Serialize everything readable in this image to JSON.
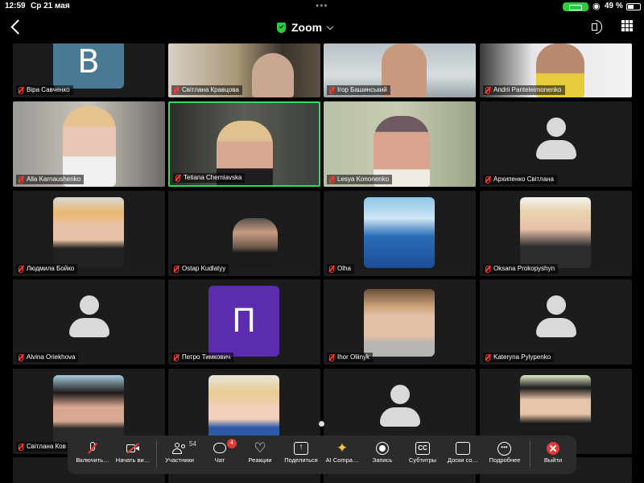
{
  "status_bar": {
    "time": "12:59",
    "date": "Ср 21 мая",
    "battery_percent": "49 %",
    "battery_level": 49
  },
  "header": {
    "title": "Zoom",
    "secure_icon": "shield-check-icon",
    "back_icon": "chevron-left-icon",
    "audio_icon": "speaker-icon",
    "layout_icon": "grid-icon"
  },
  "participants": [
    {
      "name": "Віра Савченко",
      "tile": "letter",
      "letter": "В",
      "bg": "#4a7a93"
    },
    {
      "name": "Світлана Кравцова",
      "tile": "video"
    },
    {
      "name": "Ігор Башинський",
      "tile": "video"
    },
    {
      "name": "Andrii Panteleimonenko",
      "tile": "video"
    },
    {
      "name": "Alla Karnaushenko",
      "tile": "video"
    },
    {
      "name": "Tetiana Cherniavska",
      "tile": "video",
      "active_speaker": true
    },
    {
      "name": "Lesya Kononenko",
      "tile": "video"
    },
    {
      "name": "Архипенко Світлана",
      "tile": "avatar"
    },
    {
      "name": "Людмила Бойко",
      "tile": "photo"
    },
    {
      "name": "Ostap Kudlatyy",
      "tile": "photo"
    },
    {
      "name": "Olha",
      "tile": "photo"
    },
    {
      "name": "Oksana Prokopyshyn",
      "tile": "photo"
    },
    {
      "name": "Alvina Oriekhova",
      "tile": "avatar"
    },
    {
      "name": "Петро Тимкович",
      "tile": "letter",
      "letter": "П",
      "bg": "#5b2bb0"
    },
    {
      "name": "Ihor Oliinyk",
      "tile": "photo"
    },
    {
      "name": "Kateryna Pylypenko",
      "tile": "avatar"
    },
    {
      "name": "Світлана Ков",
      "tile": "photo"
    },
    {
      "name": "",
      "tile": "photo"
    },
    {
      "name": "",
      "tile": "avatar"
    },
    {
      "name": "",
      "tile": "photo"
    }
  ],
  "toolbar": {
    "unmute": "Включить…",
    "start_video": "Начать ви…",
    "participants": "Участники",
    "participants_count": "54",
    "chat": "Чат",
    "chat_badge": "4",
    "reactions": "Реакции",
    "share": "Поделиться",
    "ai_companion": "AI Compa…",
    "record": "Запись",
    "captions": "Субтитры",
    "captions_icon_text": "CC",
    "whiteboards": "Доски со…",
    "more": "Подробнее",
    "leave": "Выйти"
  }
}
